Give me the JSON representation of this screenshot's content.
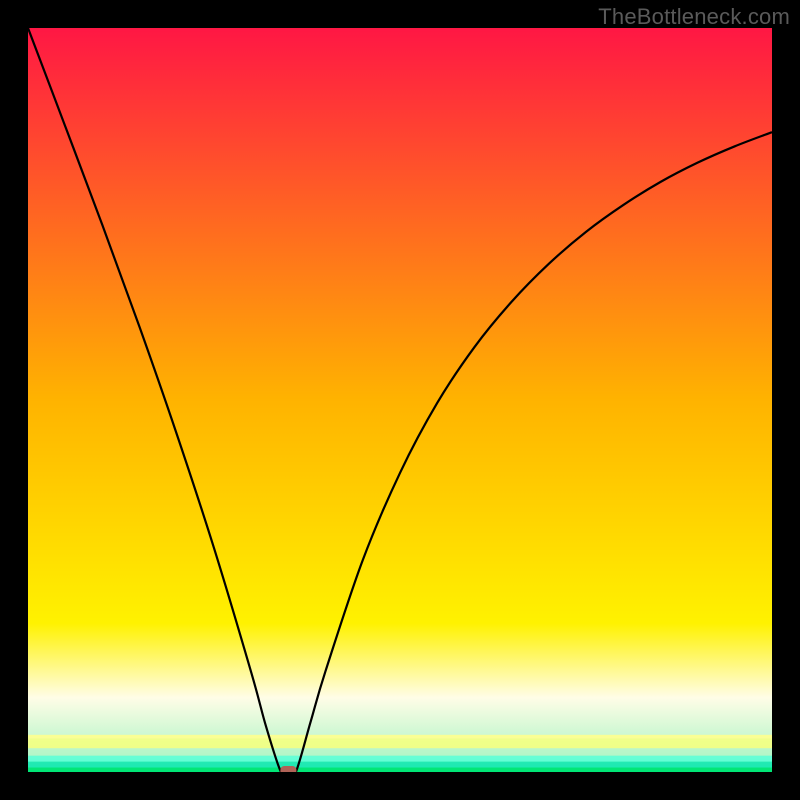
{
  "watermark": "TheBottleneck.com",
  "chart_data": {
    "type": "line",
    "title": "",
    "xlabel": "",
    "ylabel": "",
    "xlim": [
      0,
      100
    ],
    "ylim": [
      0,
      100
    ],
    "grid": false,
    "legend": false,
    "axes_visible": false,
    "series": [
      {
        "name": "curve",
        "x": [
          0,
          5,
          10,
          15,
          20,
          25,
          30,
          32,
          34,
          35,
          36,
          38,
          40,
          45,
          50,
          55,
          60,
          65,
          70,
          75,
          80,
          85,
          90,
          95,
          100
        ],
        "y": [
          100,
          86.8,
          73.5,
          59.8,
          45.4,
          30.1,
          13.4,
          6.1,
          0,
          0,
          0,
          6.8,
          13.6,
          28.5,
          40.2,
          49.6,
          57.1,
          63.2,
          68.3,
          72.6,
          76.2,
          79.3,
          81.9,
          84.1,
          86.0
        ]
      }
    ],
    "marker": {
      "x": 35,
      "y": 0,
      "color": "#b06357"
    },
    "green_band": {
      "from": 0,
      "to": 5
    },
    "background_gradient": {
      "type": "vertical",
      "stops": [
        {
          "pos": 0.0,
          "color": "#ff1744"
        },
        {
          "pos": 0.5,
          "color": "#ffb300"
        },
        {
          "pos": 0.8,
          "color": "#fff200"
        },
        {
          "pos": 0.9,
          "color": "#fffde7"
        },
        {
          "pos": 0.97,
          "color": "#b9f6ca"
        },
        {
          "pos": 1.0,
          "color": "#00e676"
        }
      ]
    }
  }
}
